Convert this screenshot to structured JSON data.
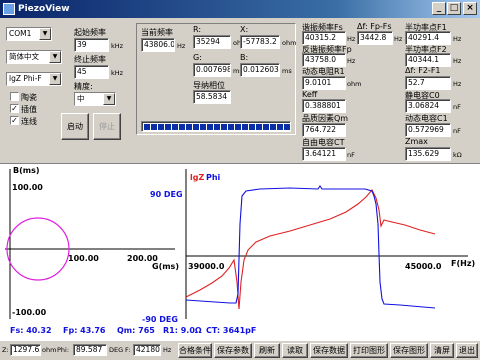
{
  "window": {
    "title": "PiezoView"
  },
  "left_panel": {
    "port_select": "COM1",
    "lang_select": "简体中文",
    "display_select": "lgZ Phi-F",
    "checkboxes": [
      {
        "label": "陶瓷",
        "checked": false
      },
      {
        "label": "插值",
        "checked": true
      },
      {
        "label": "连线",
        "checked": true
      }
    ],
    "start_freq_label": "起始频率",
    "start_freq_value": "39",
    "start_freq_unit": "kHz",
    "end_freq_label": "终止频率",
    "end_freq_value": "45",
    "end_freq_unit": "kHz",
    "precision_label": "精度:",
    "precision_value": "中",
    "start_button": "启动",
    "stop_button": "停止"
  },
  "measure_panel": {
    "cur_freq_label": "当前频率",
    "cur_freq_value": "43806.0",
    "cur_freq_unit": "Hz",
    "r_label": "R:",
    "r_value": "35294",
    "r_unit": "ohm",
    "x_label": "X:",
    "x_value": "-57783.2",
    "x_unit": "ohm",
    "g_label": "G:",
    "g_value": "0.007698",
    "g_unit": "ms",
    "b_label": "B:",
    "b_value": "0.012603",
    "b_unit": "ms",
    "phase_label": "导纳相位",
    "phase_value": "58.5834"
  },
  "params": {
    "fs_label": "谐振频率Fs",
    "fs_value": "40315.2",
    "fs_unit": "Hz",
    "dfs_label": "Δf: Fp-Fs",
    "dfs_value": "3442.8",
    "dfs_unit": "Hz",
    "f1_label": "半功率点F1",
    "f1_value": "40291.4",
    "f1_unit": "Hz",
    "fp_label": "反谐振频率Fp",
    "fp_value": "43758.0",
    "fp_unit": "Hz",
    "f2_label": "半功率点F2",
    "f2_value": "40344.1",
    "f2_unit": "Hz",
    "r1_label": "动态电阻R1",
    "r1_value": "9.0101",
    "r1_unit": "ohm",
    "df2_label": "Δf: F2-F1",
    "df2_value": "52.7",
    "df2_unit": "Hz",
    "keff_label": "Keff",
    "keff_value": "0.388801",
    "c0_label": "静电容C0",
    "c0_value": "3.06824",
    "c0_unit": "nF",
    "qm_label": "品质因素Qm",
    "qm_value": "764.722",
    "c1_label": "动态电容C1",
    "c1_value": "0.572969",
    "c1_unit": "nF",
    "ct_label": "自由电容CT",
    "ct_value": "3.64121",
    "ct_unit": "nF",
    "zmax_label": "Zmax",
    "zmax_value": "135.629",
    "zmax_unit": "kΩ"
  },
  "admittance_chart": {
    "y_title": "B(ms)",
    "x_title": "G(ms)",
    "yticks": [
      "100.00",
      "-100.00"
    ],
    "xticks": [
      "100.00",
      "200.00"
    ],
    "color": "#e020e0"
  },
  "freq_chart": {
    "title_lgz": "lgZ",
    "title_phi": "Phi",
    "left_top": "90 DEG",
    "left_bottom": "-90 DEG",
    "x_start": "39000.0",
    "x_end": "45000.0",
    "x_unit": "F(Hz)",
    "colors": {
      "lgz": "#e02020",
      "phi": "#1010e0"
    }
  },
  "summary": {
    "fs": "Fs: 40.32",
    "fp": "Fp: 43.76",
    "qm": "Qm: 765",
    "r1": "R1: 9.0Ω",
    "ct": "CT: 3641pF"
  },
  "bottom": {
    "z_label": "Z:",
    "z_value": "1297.65",
    "z_unit": "ohm",
    "phi_label": "Phi:",
    "phi_value": "89.587",
    "phi_unit": "DEG",
    "f_label": "F:",
    "f_value": "42180",
    "f_unit": "Hz",
    "buttons": [
      "合格条件",
      "保存参数",
      "刷新",
      "读取",
      "保存数据",
      "打印图形",
      "保存图形",
      "清屏",
      "退出"
    ]
  }
}
